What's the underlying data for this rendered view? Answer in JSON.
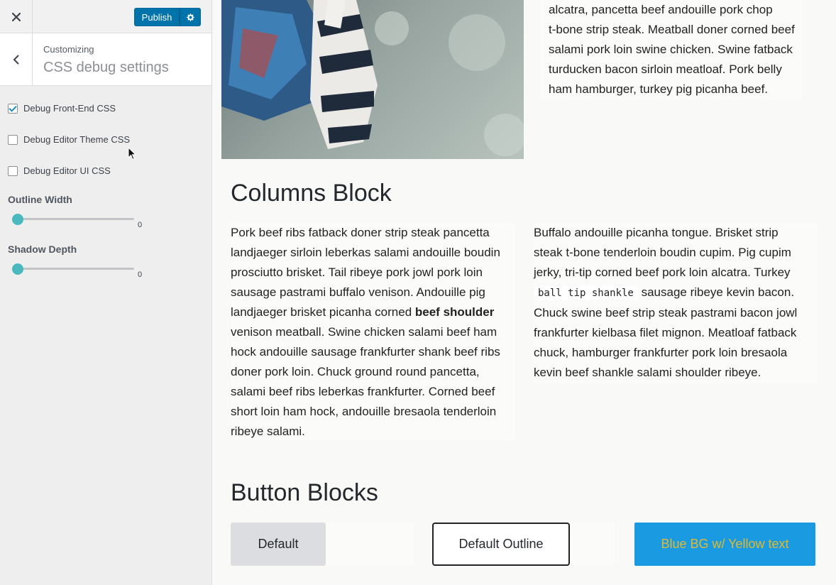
{
  "sidebar": {
    "close_label": "×",
    "publish_label": "Publish",
    "header": {
      "customizing_label": "Customizing",
      "title": "CSS debug settings"
    },
    "checkboxes": [
      {
        "label": "Debug Front-End CSS",
        "checked": true
      },
      {
        "label": "Debug Editor Theme CSS",
        "checked": false
      },
      {
        "label": "Debug Editor UI CSS",
        "checked": false
      }
    ],
    "sliders": [
      {
        "title": "Outline Width",
        "value": "0"
      },
      {
        "title": "Shadow Depth",
        "value": "0"
      }
    ]
  },
  "preview": {
    "top_text_lines": [
      "alcatra, pancetta beef andouille pork chop",
      "t-bone strip steak. Meatball doner corned beef",
      "salami pork loin swine chicken. Swine fatback",
      "turducken bacon sirloin meatloaf. Pork belly",
      "ham hamburger, turkey pig picanha beef."
    ],
    "columns_heading": "Columns Block",
    "column_left": {
      "lines": [
        "Pork beef ribs fatback doner strip steak pancetta",
        "landjaeger sirloin leberkas salami andouille boudin",
        "prosciutto brisket. Tail ribeye pork jowl pork loin",
        "sausage pastrami buffalo venison. Andouille pig"
      ],
      "line5_text": "landjaeger brisket picanha corned ",
      "line5_bold": "beef shoulder",
      "lines_after": [
        "venison meatball. Swine chicken salami beef ham",
        "hock andouille sausage frankfurter shank beef ribs",
        "doner pork loin. Chuck ground round pancetta,",
        "salami beef ribs leberkas frankfurter. Corned beef",
        "short loin ham hock, andouille bresaola tenderloin",
        "ribeye salami."
      ]
    },
    "column_right": {
      "lines_before": [
        "Buffalo andouille picanha tongue. Brisket strip",
        "steak t-bone tenderloin boudin cupim. Pig cupim",
        "jerky, tri-tip corned beef pork loin alcatra. Turkey"
      ],
      "code_text": "ball tip shankle",
      "line4_after": " sausage ribeye kevin bacon.",
      "lines_after": [
        "Chuck swine beef strip steak pastrami bacon jowl",
        "frankfurter kielbasa filet mignon. Meatloaf fatback",
        "chuck, hamburger frankfurter pork loin bresaola",
        "kevin beef shankle salami shoulder ribeye."
      ]
    },
    "buttons_heading": "Button Blocks",
    "buttons": {
      "default": "Default",
      "outline": "Default Outline",
      "blue": "Blue BG w/ Yellow text"
    }
  },
  "colors": {
    "publish_blue": "#0073aa",
    "slider_thumb": "#4ab9bd",
    "blue_button_bg": "#1a9ae0",
    "blue_button_text": "#e3b92f"
  }
}
